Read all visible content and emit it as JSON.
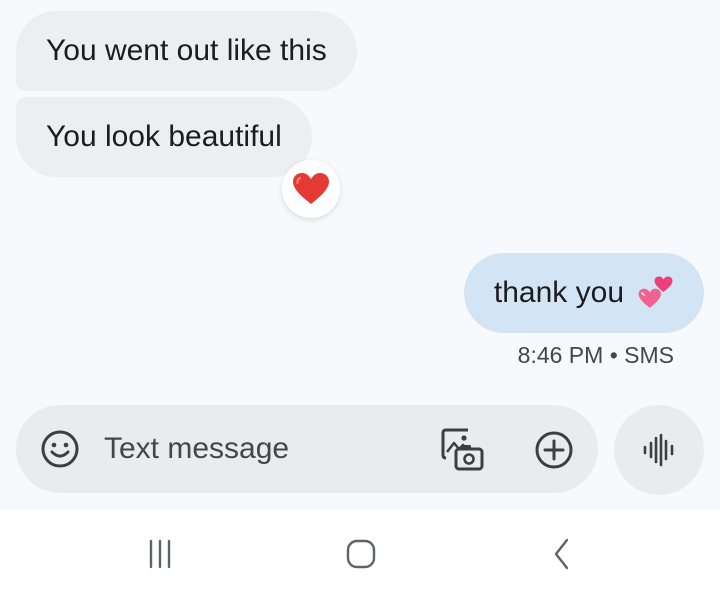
{
  "messages": {
    "incoming": [
      {
        "text": "You went out like this"
      },
      {
        "text": "You look beautiful",
        "reaction_icon": "red-heart-icon"
      }
    ],
    "outgoing": {
      "text": "thank you",
      "emoji_icon": "two-hearts-icon",
      "time": "8:46 PM",
      "separator": "•",
      "channel": "SMS"
    }
  },
  "compose": {
    "placeholder": "Text message",
    "value": "",
    "emoji_icon": "smiley-icon",
    "gallery_icon": "gallery-camera-icon",
    "attach_icon": "plus-circle-icon",
    "voice_icon": "voice-waveform-icon"
  },
  "nav": {
    "recents_icon": "recents-icon",
    "home_icon": "home-icon",
    "back_icon": "back-icon"
  },
  "colors": {
    "incoming_bubble": "#eceef1",
    "outgoing_bubble": "#d3e4f5",
    "chat_background": "#f8f9fc",
    "reaction_heart": "#e53935",
    "icon": "#3c3f42"
  }
}
